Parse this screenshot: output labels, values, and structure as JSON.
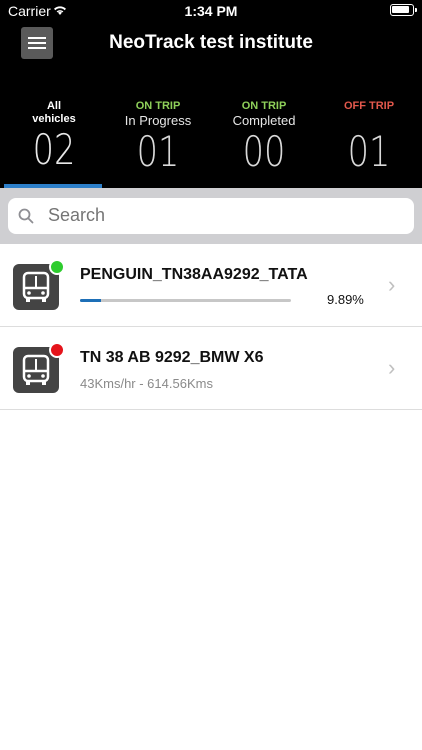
{
  "status_bar": {
    "carrier": "Carrier",
    "time": "1:34 PM"
  },
  "header": {
    "title": "NeoTrack test institute"
  },
  "tabs": [
    {
      "line1": "All",
      "line2": "vehicles",
      "count": "02",
      "color": "#ffffff"
    },
    {
      "line1": "ON TRIP",
      "line2": "In Progress",
      "count": "01",
      "color": "#8fd05a"
    },
    {
      "line1": "ON TRIP",
      "line2": "Completed",
      "count": "00",
      "color": "#8fd05a"
    },
    {
      "line1": "OFF TRIP",
      "line2": "",
      "count": "01",
      "color": "#e2584c"
    }
  ],
  "search": {
    "placeholder": "Search"
  },
  "vehicles": [
    {
      "name": "PENGUIN_TN38AA9292_TATA",
      "progress_percent": 9.89,
      "percent_label": "9.89%",
      "status_color": "#2ecc2e"
    },
    {
      "name": "TN 38 AB 9292_BMW X6",
      "detail": "43Kms/hr - 614.56Kms",
      "status_color": "#e5141b"
    }
  ],
  "colors": {
    "accent": "#2d7fc9"
  }
}
